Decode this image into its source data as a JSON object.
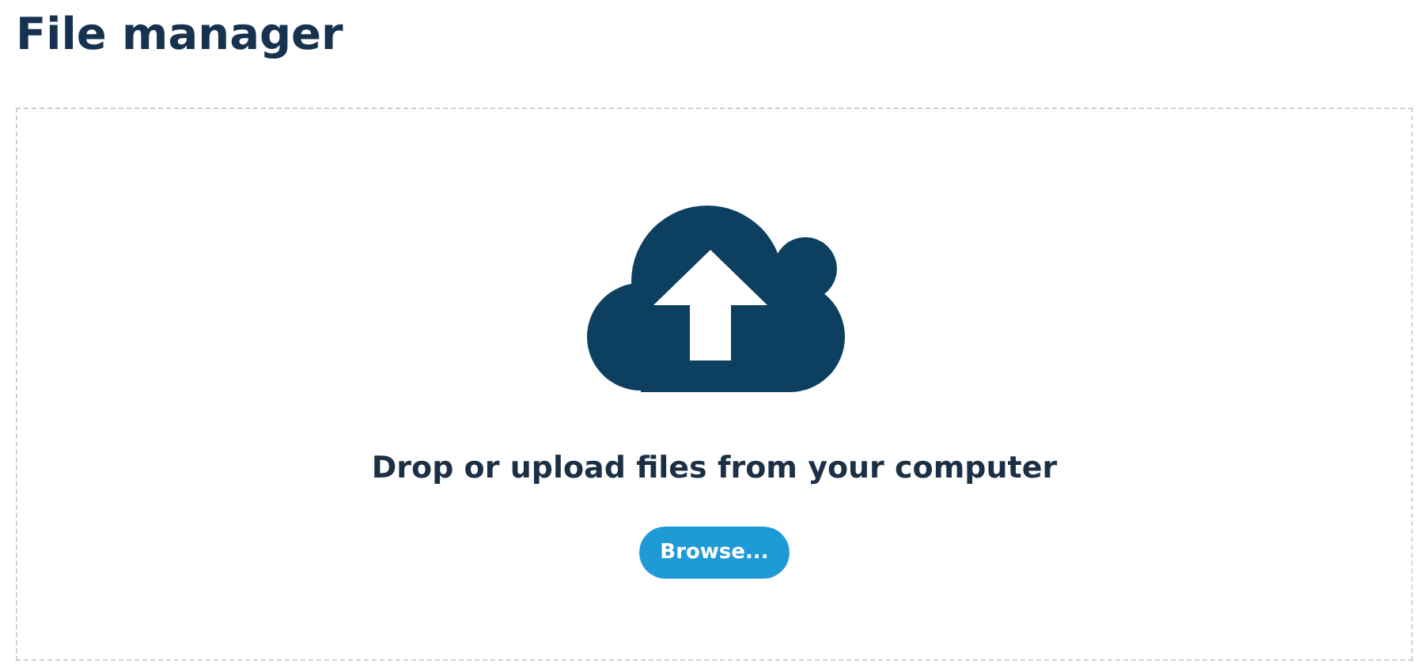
{
  "title": "File manager",
  "dropzone": {
    "message": "Drop or upload files from your computer",
    "button": "Browse..."
  }
}
